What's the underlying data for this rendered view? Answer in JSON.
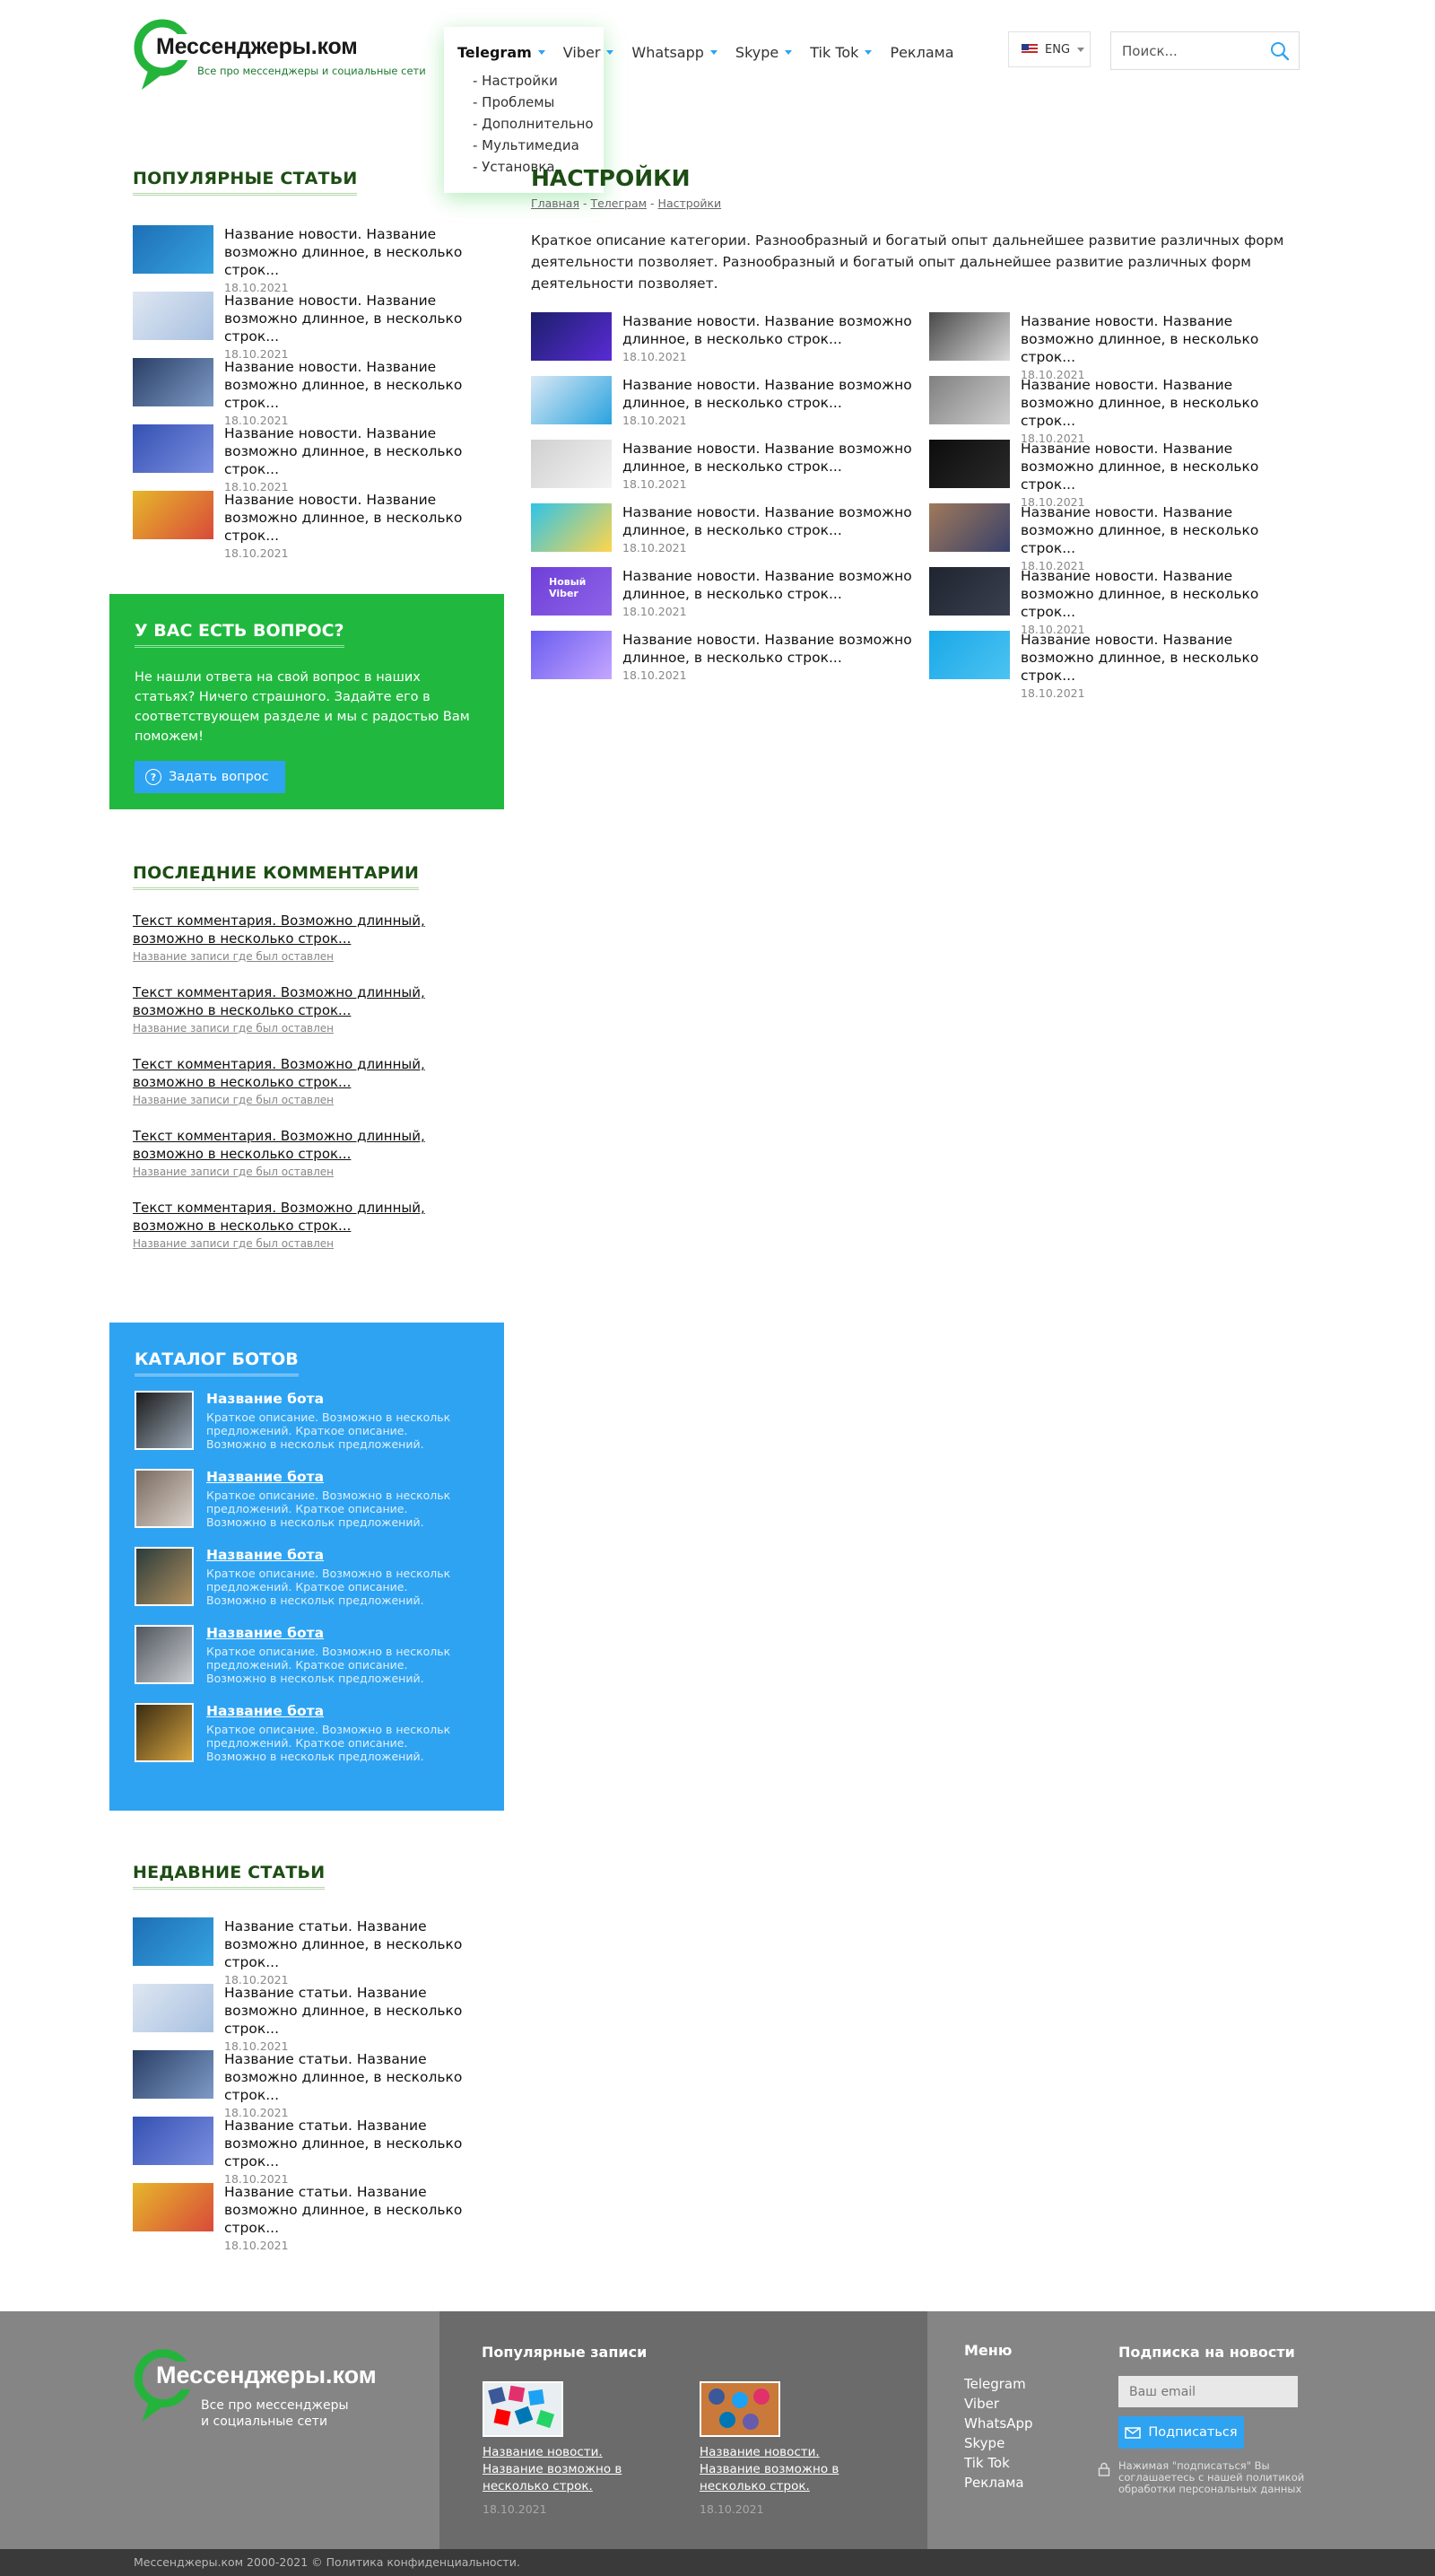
{
  "header": {
    "logo_title": "Мессенджеры.ком",
    "logo_subtitle": "Все про мессенджеры и социальные сети",
    "nav": [
      "Telegram",
      "Viber",
      "Whatsapp",
      "Skype",
      "Tik Tok",
      "Реклама"
    ],
    "dropdown": [
      "- Настройки",
      "- Проблемы",
      "- Дополнительно",
      "- Мультимедиа",
      "- Установка"
    ],
    "lang": "ENG",
    "search_placeholder": "Поиск..."
  },
  "sidebar": {
    "popular_title": "Популярные статьи",
    "popular": [
      {
        "title": "Название новости. Название возможно длинное, в несколько строк...",
        "date": "18.10.2021"
      },
      {
        "title": "Название новости. Название возможно длинное, в несколько строк...",
        "date": "18.10.2021"
      },
      {
        "title": "Название новости. Название возможно длинное, в несколько строк...",
        "date": "18.10.2021"
      },
      {
        "title": "Название новости. Название возможно длинное, в несколько строк...",
        "date": "18.10.2021"
      },
      {
        "title": "Название новости. Название возможно длинное, в несколько строк...",
        "date": "18.10.2021"
      }
    ],
    "question_title": "У вас есть вопрос?",
    "question_text": "Не нашли ответа на свой вопрос в наших статьях? Ничего страшного. Задайте его в соответствующем разделе и мы с радостью Вам поможем!",
    "question_button": "Задать вопрос",
    "comments_title": "Последние комментарии",
    "comments": [
      {
        "text": "Текст комментария. Возможно длинный, возможно в несколько строк...",
        "post": "Название записи где был оставлен"
      },
      {
        "text": "Текст комментария. Возможно длинный, возможно в несколько строк...",
        "post": "Название записи где был оставлен"
      },
      {
        "text": "Текст комментария. Возможно длинный, возможно в несколько строк...",
        "post": "Название записи где был оставлен"
      },
      {
        "text": "Текст комментария. Возможно длинный, возможно в несколько строк...",
        "post": "Название записи где был оставлен"
      },
      {
        "text": "Текст комментария. Возможно длинный, возможно в несколько строк...",
        "post": "Название записи где был оставлен"
      }
    ],
    "bots_title": "Каталог ботов",
    "bots": [
      {
        "name": "Название бота",
        "desc": "Краткое описание. Возможно в нескольк предложений. Краткое описание. Возможно в нескольк предложений."
      },
      {
        "name": "Название бота",
        "desc": "Краткое описание. Возможно в нескольк предложений. Краткое описание. Возможно в нескольк предложений."
      },
      {
        "name": "Название бота",
        "desc": "Краткое описание. Возможно в нескольк предложений. Краткое описание. Возможно в нескольк предложений."
      },
      {
        "name": "Название бота",
        "desc": "Краткое описание. Возможно в нескольк предложений. Краткое описание. Возможно в нескольк предложений."
      },
      {
        "name": "Название бота",
        "desc": "Краткое описание. Возможно в нескольк предложений. Краткое описание. Возможно в нескольк предложений."
      }
    ],
    "recent_title": "Недавние статьи",
    "recent": [
      {
        "title": "Название статьи. Название возможно длинное, в несколько строк...",
        "date": "18.10.2021"
      },
      {
        "title": "Название статьи. Название возможно длинное, в несколько строк...",
        "date": "18.10.2021"
      },
      {
        "title": "Название статьи. Название возможно длинное, в несколько строк...",
        "date": "18.10.2021"
      },
      {
        "title": "Название статьи. Название возможно длинное, в несколько строк...",
        "date": "18.10.2021"
      },
      {
        "title": "Название статьи. Название возможно длинное, в несколько строк...",
        "date": "18.10.2021"
      }
    ]
  },
  "main": {
    "title": "Настройки",
    "breadcrumb": [
      "Главная",
      "Телеграм",
      "Настройки"
    ],
    "breadcrumb_sep": " - ",
    "description": "Краткое описание категории. Разнообразный и богатый опыт дальнейшее развитие различных форм деятельности позволяет. Разнообразный и богатый опыт дальнейшее развитие различных форм деятельности позволяет.",
    "articles": [
      {
        "title": "Название новости. Название возможно длинное, в несколько строк...",
        "date": "18.10.2021"
      },
      {
        "title": "Название новости. Название возможно длинное, в несколько строк...",
        "date": "18.10.2021"
      },
      {
        "title": "Название новости. Название возможно длинное, в несколько строк...",
        "date": "18.10.2021"
      },
      {
        "title": "Название новости. Название возможно длинное, в несколько строк...",
        "date": "18.10.2021"
      },
      {
        "title": "Название новости. Название возможно длинное, в несколько строк...",
        "date": "18.10.2021"
      },
      {
        "title": "Название новости. Название возможно длинное, в несколько строк...",
        "date": "18.10.2021"
      },
      {
        "title": "Название новости. Название возможно длинное, в несколько строк...",
        "date": "18.10.2021"
      },
      {
        "title": "Название новости. Название возможно длинное, в несколько строк...",
        "date": "18.10.2021"
      },
      {
        "title": "Название новости. Название возможно длинное, в несколько строк...",
        "date": "18.10.2021"
      },
      {
        "title": "Название новости. Название возможно длинное, в несколько строк...",
        "date": "18.10.2021"
      },
      {
        "title": "Название новости. Название возможно длинное, в несколько строк...",
        "date": "18.10.2021"
      },
      {
        "title": "Название новости. Название возможно длинное, в несколько строк...",
        "date": "18.10.2021"
      }
    ],
    "thumb_badges": {
      "viber": "Новый Viber"
    }
  },
  "footer": {
    "logo_title": "Мессенджеры.ком",
    "logo_subtitle_1": "Все про мессенджеры",
    "logo_subtitle_2": "и социальные сети",
    "popular_title": "Популярные записи",
    "popular": [
      {
        "title": "Название новости. Название возможно в несколько строк.",
        "date": "18.10.2021"
      },
      {
        "title": "Название новости. Название возможно в несколько строк.",
        "date": "18.10.2021"
      }
    ],
    "menu_title": "Меню",
    "menu": [
      "Telegram",
      "Viber",
      "WhatsApp",
      "Skype",
      "Tik Tok",
      "Реклама"
    ],
    "subscribe_title": "Подписка на новости",
    "email_placeholder": "Ваш email",
    "subscribe_button": "Подписаться",
    "consent": "Нажимая \"подписаться\" Вы соглашаетесь с нашей политикой обработки персональных данных",
    "copyright": "Мессенджеры.ком 2000-2021 © Политика конфиденциальности."
  },
  "colors": {
    "brand_green": "#21b83f",
    "heading_green": "#1d4d14",
    "accent_blue": "#2ea3f2",
    "footer_gray": "#858585"
  }
}
